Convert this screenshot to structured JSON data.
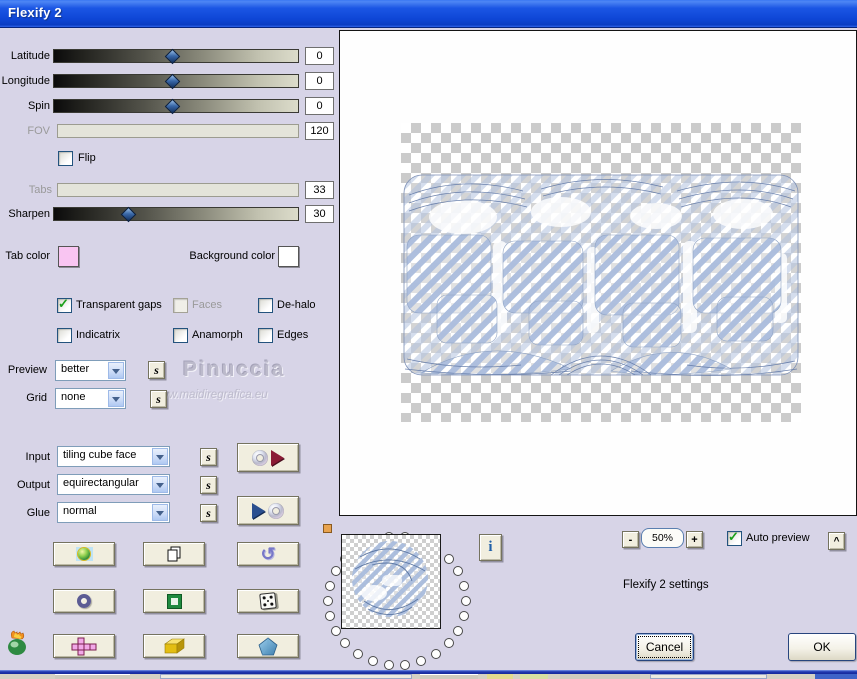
{
  "window": {
    "title": "Flexify 2"
  },
  "sliders": {
    "latitude": {
      "label": "Latitude",
      "value": "0",
      "percent": 48,
      "disabled": false
    },
    "longitude": {
      "label": "Longitude",
      "value": "0",
      "percent": 48,
      "disabled": false
    },
    "spin": {
      "label": "Spin",
      "value": "0",
      "percent": 48,
      "disabled": false
    },
    "fov": {
      "label": "FOV",
      "value": "120",
      "disabled": true
    },
    "tabs": {
      "label": "Tabs",
      "value": "33",
      "disabled": true
    },
    "sharpen": {
      "label": "Sharpen",
      "value": "30",
      "percent": 30,
      "disabled": false
    }
  },
  "flip": {
    "label": "Flip",
    "checked": false
  },
  "color_pickers": {
    "tab_color": {
      "label": "Tab color",
      "value": "#F9C5F2"
    },
    "background_color": {
      "label": "Background color",
      "value": "#FFFFFF"
    }
  },
  "options": {
    "transparent_gaps": {
      "label": "Transparent gaps",
      "checked": true,
      "disabled": false
    },
    "faces": {
      "label": "Faces",
      "checked": false,
      "disabled": true
    },
    "dehalo": {
      "label": "De-halo",
      "checked": false,
      "disabled": false
    },
    "indicatrix": {
      "label": "Indicatrix",
      "checked": false,
      "disabled": false
    },
    "anamorph": {
      "label": "Anamorph",
      "checked": false,
      "disabled": false
    },
    "edges": {
      "label": "Edges",
      "checked": false,
      "disabled": false
    }
  },
  "selects": {
    "preview": {
      "label": "Preview",
      "value": "better"
    },
    "grid": {
      "label": "Grid",
      "value": "none"
    },
    "input": {
      "label": "Input",
      "value": "tiling cube face"
    },
    "output": {
      "label": "Output",
      "value": "equirectangular"
    },
    "glue": {
      "label": "Glue",
      "value": "normal"
    }
  },
  "s_button_label": "s",
  "watermark": {
    "name": "Pinuccia",
    "url": "www.maidiregrafica.eu"
  },
  "info_button_label": "i",
  "zoom": {
    "minus": "-",
    "level": "50%",
    "plus": "+"
  },
  "auto_preview": {
    "label": "Auto preview",
    "checked": true
  },
  "expand_button_label": "^",
  "settings_caption": "Flexify 2 settings",
  "actions": {
    "cancel": "Cancel",
    "ok": "OK"
  },
  "glyphs": {
    "check": "✓",
    "undo": "↺"
  },
  "icon_buttons": [
    {
      "icon": "globe-icon"
    },
    {
      "icon": "copy-pages-icon"
    },
    {
      "icon": "undo-arrow-icon"
    },
    {
      "icon": "torus-icon"
    },
    {
      "icon": "square-frame-icon"
    },
    {
      "icon": "dice-icon"
    },
    {
      "icon": "cube-net-icon"
    },
    {
      "icon": "brick-icon"
    },
    {
      "icon": "pentagon-icon"
    }
  ],
  "accent_colors": {
    "titlebar_blue": "#0F47D8",
    "dialog_bg": "#D7D4E7",
    "button_cream": "#F1EEDF"
  }
}
